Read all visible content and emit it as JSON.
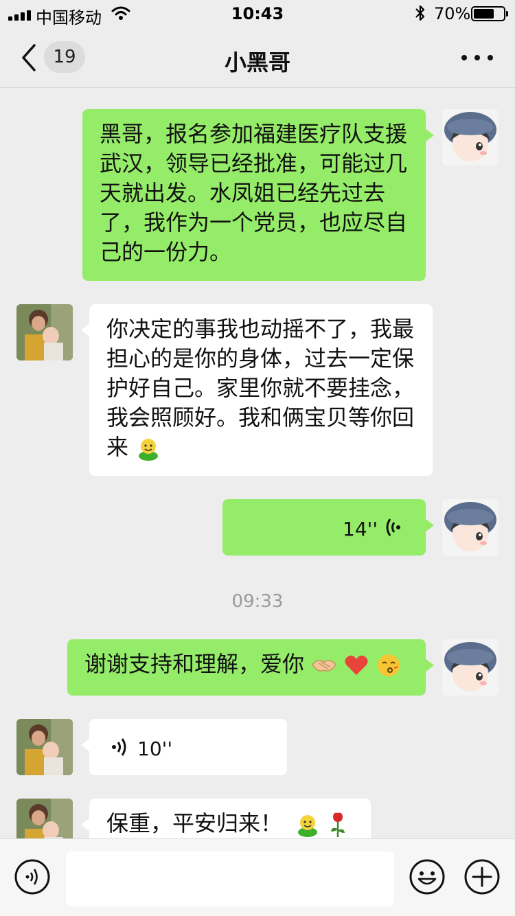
{
  "status_bar": {
    "carrier": "中国移动",
    "time": "10:43",
    "battery_percent": "70%",
    "battery_level": 0.7,
    "icons": [
      "signal-icon",
      "wifi-icon",
      "bluetooth-icon",
      "battery-icon"
    ]
  },
  "nav": {
    "back_icon": "chevron-left-icon",
    "unread_count": "19",
    "title": "小黑哥",
    "more_icon": "more-dots-icon"
  },
  "messages": {
    "m1": {
      "sender": "me",
      "text": "黑哥，报名参加福建医疗队支援武汉，领导已经批准，可能过几天就出发。水凤姐已经先过去了，我作为一个党员，也应尽自己的一份力。"
    },
    "m2": {
      "sender": "other",
      "text": "你决定的事我也动摇不了，我最担心的是你的身体，过去一定保护好自己。家里你就不要挂念，我会照顾好。我和俩宝贝等你回来",
      "emoji": "smile-green-emoji"
    },
    "m3": {
      "sender": "me",
      "type": "voice",
      "duration": "14''"
    },
    "timestamp": "09:33",
    "m4": {
      "sender": "me",
      "text": "谢谢支持和理解，爱你",
      "emojis": [
        "handshake-emoji",
        "heart-emoji",
        "kiss-emoji"
      ]
    },
    "m5": {
      "sender": "other",
      "type": "voice",
      "duration": "10''"
    },
    "m6": {
      "sender": "other",
      "text": "保重，平安归来！",
      "emojis": [
        "smile-green-emoji",
        "rose-emoji"
      ]
    }
  },
  "input_bar": {
    "voice_icon": "voice-input-icon",
    "emoji_icon": "emoji-face-icon",
    "plus_icon": "plus-icon",
    "placeholder": ""
  },
  "colors": {
    "background": "#ededed",
    "my_bubble": "#95ec69",
    "their_bubble": "#ffffff",
    "timestamp": "#9a9a9a"
  }
}
